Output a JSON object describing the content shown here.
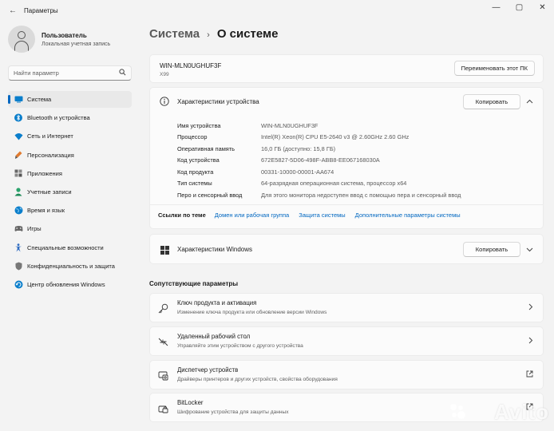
{
  "window": {
    "title": "Параметры",
    "back_icon": "←",
    "controls": [
      "—",
      "▢",
      "✕"
    ]
  },
  "user": {
    "name": "Пользователь",
    "account_type": "Локальная учетная запись"
  },
  "search": {
    "placeholder": "Найти параметр"
  },
  "sidebar": {
    "items": [
      {
        "label": "Система",
        "icon": "system-icon",
        "color": "#0067c0"
      },
      {
        "label": "Bluetooth и устройства",
        "icon": "bluetooth-icon",
        "color": "#0067c0"
      },
      {
        "label": "Сеть и Интернет",
        "icon": "network-icon",
        "color": "#0067c0"
      },
      {
        "label": "Персонализация",
        "icon": "paint-icon",
        "color": "#e07a2f"
      },
      {
        "label": "Приложения",
        "icon": "apps-icon",
        "color": "#555555"
      },
      {
        "label": "Учетные записи",
        "icon": "accounts-icon",
        "color": "#2aa36b"
      },
      {
        "label": "Время и язык",
        "icon": "globe-icon",
        "color": "#0a7ecb"
      },
      {
        "label": "Игры",
        "icon": "gaming-icon",
        "color": "#666666"
      },
      {
        "label": "Специальные возможности",
        "icon": "accessibility-icon",
        "color": "#2f6cc1"
      },
      {
        "label": "Конфиденциальность и защита",
        "icon": "shield-icon",
        "color": "#666666"
      },
      {
        "label": "Центр обновления Windows",
        "icon": "update-icon",
        "color": "#0a7ecb"
      }
    ]
  },
  "breadcrumb": {
    "parent": "Система",
    "current": "О системе"
  },
  "device_card": {
    "pc_name": "WIN-MLN0UGHUF3F",
    "model": "X99",
    "rename_button": "Переименовать этот ПК"
  },
  "device_specs": {
    "title": "Характеристики устройства",
    "copy_button": "Копировать",
    "rows": [
      {
        "key": "Имя устройства",
        "value": "WIN-MLN0UGHUF3F"
      },
      {
        "key": "Процессор",
        "value": "Intel(R) Xeon(R) CPU E5-2640 v3 @ 2.60GHz   2.60 GHz"
      },
      {
        "key": "Оперативная память",
        "value": "16,0 ГБ (доступно: 15,8 ГБ)"
      },
      {
        "key": "Код устройства",
        "value": "672E5827-5D06-498F-ABB8-EE067168030A"
      },
      {
        "key": "Код продукта",
        "value": "00331-10000-00001-AA674"
      },
      {
        "key": "Тип системы",
        "value": "64-разрядная операционная система, процессор x64"
      },
      {
        "key": "Перо и сенсорный ввод",
        "value": "Для этого монитора недоступен ввод с помощью пера и сенсорный ввод"
      }
    ],
    "links_title": "Ссылки по теме",
    "links": [
      "Домен или рабочая группа",
      "Защита системы",
      "Дополнительные параметры системы"
    ]
  },
  "windows_specs": {
    "title": "Характеристики Windows",
    "copy_button": "Копировать"
  },
  "related": {
    "header": "Сопутствующие параметры",
    "items": [
      {
        "title": "Ключ продукта и активация",
        "subtitle": "Изменение ключа продукта или обновление версии Windows",
        "icon": "key-icon",
        "action": "chevron-right-icon"
      },
      {
        "title": "Удаленный рабочий стол",
        "subtitle": "Управляйте этим устройством с другого устройства",
        "icon": "remote-desktop-icon",
        "action": "chevron-right-icon"
      },
      {
        "title": "Диспетчер устройств",
        "subtitle": "Драйверы принтеров и других устройств, свойства оборудования",
        "icon": "device-manager-icon",
        "action": "external-link-icon"
      },
      {
        "title": "BitLocker",
        "subtitle": "Шифрование устройства для защиты данных",
        "icon": "bitlocker-icon",
        "action": "external-link-icon"
      }
    ]
  },
  "watermark": "Avito",
  "colors": {
    "accent": "#0067c0",
    "background": "#f3f3f3",
    "card": "#fbfbfb"
  }
}
